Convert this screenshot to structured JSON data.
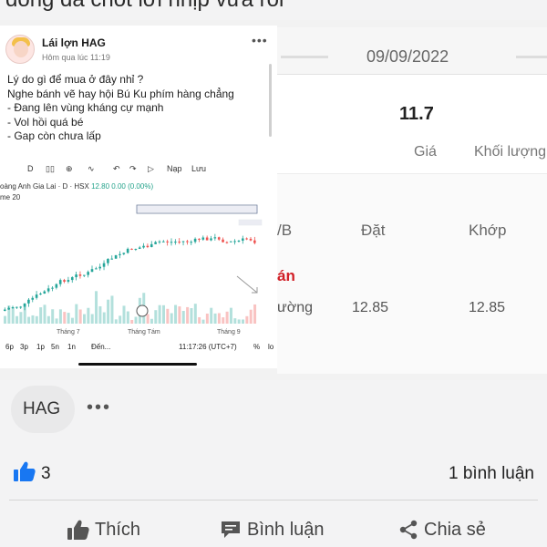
{
  "caption": "đồng đã chốt lời nhịp vừa rồi",
  "left_post": {
    "author": "Lái lợn HAG",
    "time": "Hôm qua lúc 11:19",
    "lines": [
      "Lý do gì để mua ở đây nhỉ ?",
      "Nghe bánh vẽ hay hội Bú Ku phím hàng chẳng",
      "- Đang lên vùng kháng cự mạnh",
      "- Vol hồi quá bé",
      "- Gap còn chưa lấp"
    ],
    "toolbar": {
      "d": "D",
      "nap": "Nạp",
      "luu": "Lưu"
    },
    "chart_header_name": "oàng Anh Gia Lai · D · HSX",
    "chart_header_price": "12.80 0.00 (0.00%)",
    "vol_label": "me 20",
    "time_axis": [
      "Tháng 7",
      "Tháng Tám",
      "Tháng 9"
    ],
    "bottom_tools": [
      "6p",
      "3p",
      "1p",
      "5n",
      "1n",
      "Đến...",
      "11:17:26 (UTC+7)",
      "%",
      "lo"
    ]
  },
  "right_screen": {
    "date": "09/09/2022",
    "price": "11.7",
    "header_gia": "Giá",
    "header_khoi_luong": "Khối lượng",
    "col_mb": "/B",
    "col_dat": "Đặt",
    "col_khop": "Khớp",
    "row_label_red": "án",
    "row_label": "ường",
    "val_dat": "12.85",
    "val_khop": "12.85"
  },
  "tag": "HAG",
  "tag_more": "•••",
  "reactions": {
    "like_count": "3",
    "comment_count": "1 bình luận"
  },
  "actions": {
    "like": "Thích",
    "comment": "Bình luận",
    "share": "Chia sẻ"
  },
  "colors": {
    "up_candle": "#26a69a",
    "down_candle": "#ef5350",
    "like_blue": "#1877f2",
    "red_label": "#d11f26"
  }
}
